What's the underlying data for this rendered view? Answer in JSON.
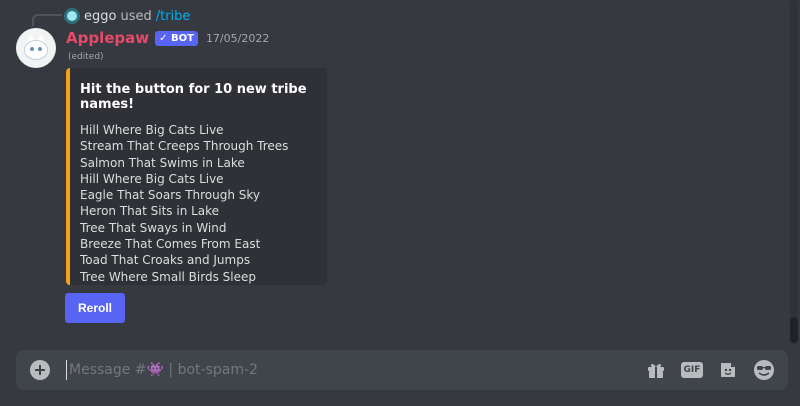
{
  "reply": {
    "user": "eggo",
    "used": "used",
    "command": "/tribe"
  },
  "message": {
    "username": "Applepaw",
    "bot_tag": "✓ BOT",
    "timestamp": "17/05/2022",
    "edited": "(edited)"
  },
  "embed": {
    "accent_color": "#f9a01b",
    "title": "Hit the button for 10 new tribe names!",
    "names": [
      "Hill Where Big Cats Live",
      "Stream That Creeps Through Trees",
      "Salmon That Swims in Lake",
      "Hill Where Big Cats Live",
      "Eagle That Soars Through Sky",
      "Heron That Sits in Lake",
      "Tree That Sways in Wind",
      "Breeze That Comes From East",
      "Toad That Croaks and Jumps",
      "Tree Where Small Birds Sleep"
    ]
  },
  "button": {
    "reroll_label": "Reroll"
  },
  "composer": {
    "placeholder": "Message #👾 | bot-spam-2",
    "gif_label": "GIF"
  },
  "colors": {
    "username": "#e8496b",
    "blurple": "#5865f2",
    "link": "#00aff4"
  }
}
